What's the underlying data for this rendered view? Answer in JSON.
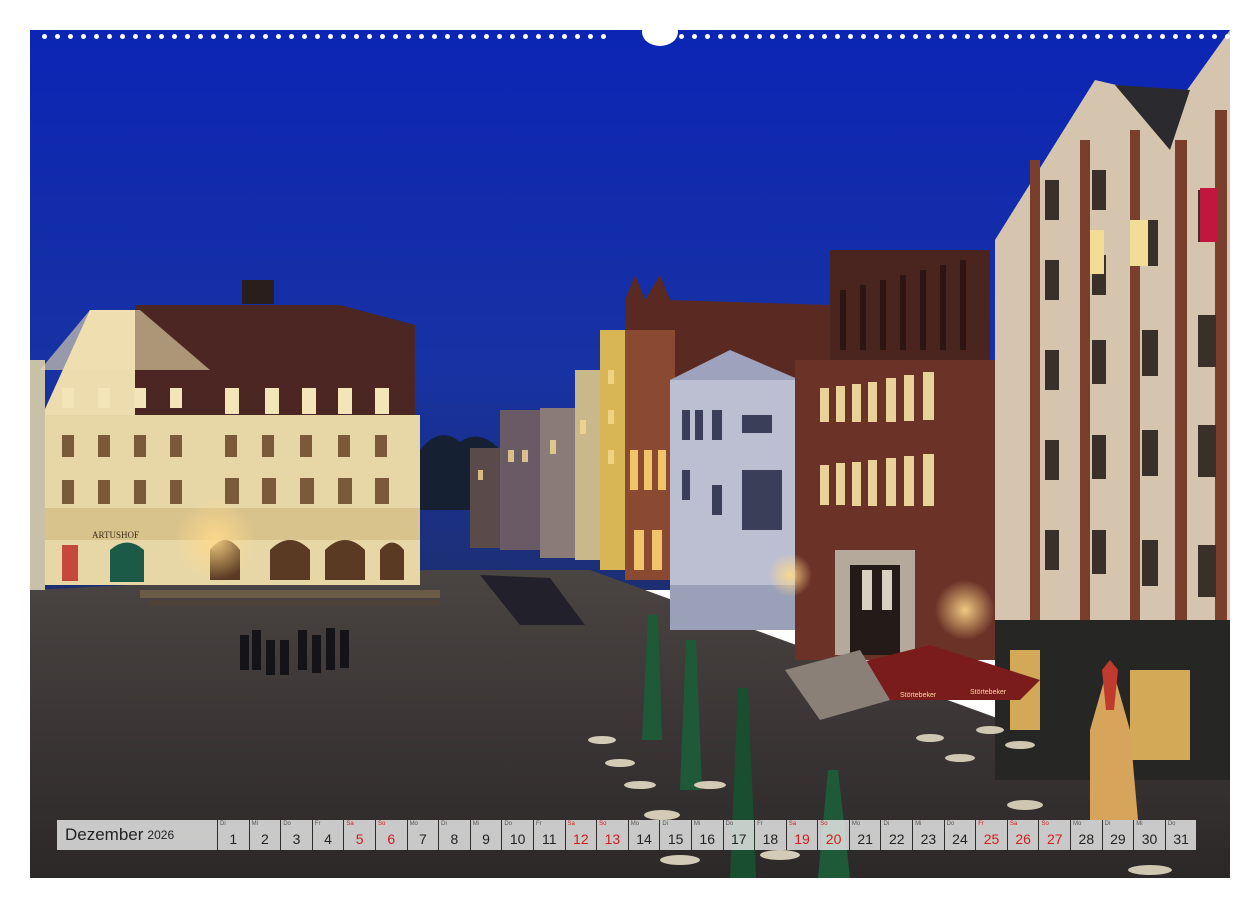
{
  "calendar": {
    "month": "Dezember",
    "year": "2026",
    "days": [
      {
        "d": "1",
        "w": "Di",
        "red": false
      },
      {
        "d": "2",
        "w": "Mi",
        "red": false
      },
      {
        "d": "3",
        "w": "Do",
        "red": false
      },
      {
        "d": "4",
        "w": "Fr",
        "red": false
      },
      {
        "d": "5",
        "w": "Sa",
        "red": true
      },
      {
        "d": "6",
        "w": "So",
        "red": true
      },
      {
        "d": "7",
        "w": "Mo",
        "red": false
      },
      {
        "d": "8",
        "w": "Di",
        "red": false
      },
      {
        "d": "9",
        "w": "Mi",
        "red": false
      },
      {
        "d": "10",
        "w": "Do",
        "red": false
      },
      {
        "d": "11",
        "w": "Fr",
        "red": false
      },
      {
        "d": "12",
        "w": "Sa",
        "red": true
      },
      {
        "d": "13",
        "w": "So",
        "red": true
      },
      {
        "d": "14",
        "w": "Mo",
        "red": false
      },
      {
        "d": "15",
        "w": "Di",
        "red": false
      },
      {
        "d": "16",
        "w": "Mi",
        "red": false
      },
      {
        "d": "17",
        "w": "Do",
        "red": false
      },
      {
        "d": "18",
        "w": "Fr",
        "red": false
      },
      {
        "d": "19",
        "w": "Sa",
        "red": true
      },
      {
        "d": "20",
        "w": "So",
        "red": true
      },
      {
        "d": "21",
        "w": "Mo",
        "red": false
      },
      {
        "d": "22",
        "w": "Di",
        "red": false
      },
      {
        "d": "23",
        "w": "Mi",
        "red": false
      },
      {
        "d": "24",
        "w": "Do",
        "red": false
      },
      {
        "d": "25",
        "w": "Fr",
        "red": true
      },
      {
        "d": "26",
        "w": "Sa",
        "red": true
      },
      {
        "d": "27",
        "w": "So",
        "red": true
      },
      {
        "d": "28",
        "w": "Mo",
        "red": false
      },
      {
        "d": "29",
        "w": "Di",
        "red": false
      },
      {
        "d": "30",
        "w": "Mi",
        "red": false
      },
      {
        "d": "31",
        "w": "Do",
        "red": false
      }
    ]
  },
  "photo": {
    "sign_artushof": "ARTUSHOF",
    "umbrella_text_left": "Störtebeker",
    "umbrella_text_right": "Störtebeker",
    "colors": {
      "sky_top": "#0d2ab8",
      "sky_bottom": "#1b2f86",
      "pavement": "#3e3a3a",
      "accent_red": "#d01c1c"
    }
  }
}
